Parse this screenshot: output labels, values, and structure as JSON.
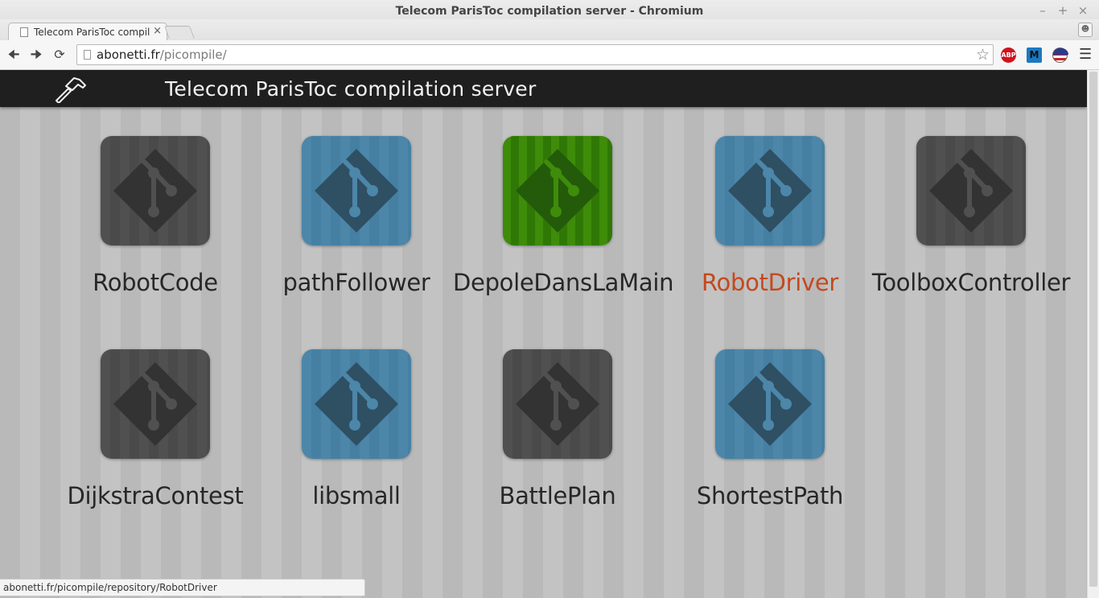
{
  "window": {
    "title": "Telecom ParisToc compilation server - Chromium",
    "minimize": "–",
    "maximize": "+",
    "close": "×"
  },
  "tab": {
    "label": "Telecom ParisToc compil",
    "close": "×"
  },
  "address": {
    "host": "abonetti.fr",
    "path": "/picompile/"
  },
  "extensions": {
    "abp": "ABP",
    "m": "M"
  },
  "header": {
    "title": "Telecom ParisToc compilation server"
  },
  "repositories": [
    {
      "name": "RobotCode",
      "color": "dark"
    },
    {
      "name": "pathFollower",
      "color": "blue"
    },
    {
      "name": "DepoleDansLaMain",
      "color": "green"
    },
    {
      "name": "RobotDriver",
      "color": "blue",
      "hovered": true
    },
    {
      "name": "ToolboxController",
      "color": "dark"
    },
    {
      "name": "DijkstraContest",
      "color": "dark"
    },
    {
      "name": "libsmall",
      "color": "blue"
    },
    {
      "name": "BattlePlan",
      "color": "dark"
    },
    {
      "name": "ShortestPath",
      "color": "blue"
    }
  ],
  "colors": {
    "hover_text": "#c3491e",
    "header_bg": "#1f1f1f",
    "green_tile": "#3e8c0a",
    "blue_tile": "#4c86a9",
    "dark_tile": "#505050"
  },
  "status": {
    "url": "abonetti.fr/picompile/repository/RobotDriver"
  }
}
